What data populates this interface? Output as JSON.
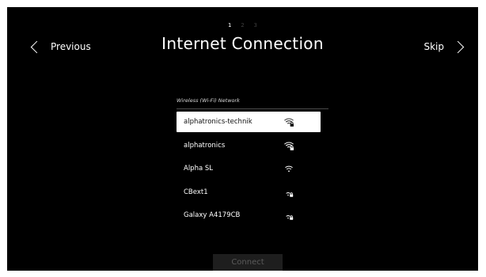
{
  "steps": [
    {
      "label": "1",
      "active": true
    },
    {
      "label": "2",
      "active": false
    },
    {
      "label": "3",
      "active": false
    }
  ],
  "header": {
    "previous_label": "Previous",
    "title": "Internet Connection",
    "skip_label": "Skip"
  },
  "section": {
    "label": "Wireless (Wi-Fi) Network"
  },
  "networks": [
    {
      "name": "alphatronics-technik",
      "icon": "wifi-secured-strong-icon",
      "selected": true
    },
    {
      "name": "alphatronics",
      "icon": "wifi-secured-strong-icon",
      "selected": false
    },
    {
      "name": "Alpha SL",
      "icon": "wifi-open-icon",
      "selected": false
    },
    {
      "name": "CBext1",
      "icon": "wifi-secured-weak-icon",
      "selected": false
    },
    {
      "name": "Galaxy A4179CB",
      "icon": "wifi-secured-weak-icon",
      "selected": false
    }
  ],
  "footer": {
    "connect_label": "Connect",
    "connect_enabled": false
  },
  "colors": {
    "background": "#000000",
    "selected_row": "#ffffff",
    "disabled_button": "#1e1e1e",
    "disabled_text": "#5a5a5a"
  }
}
